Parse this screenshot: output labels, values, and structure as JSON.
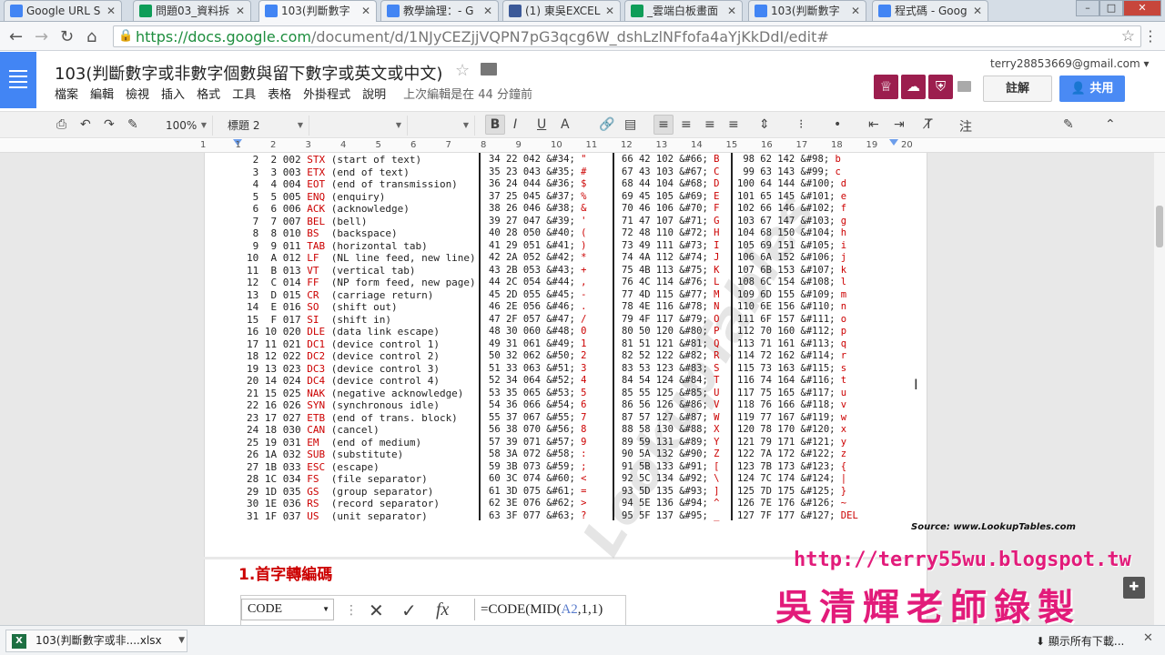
{
  "browser": {
    "tabs": [
      {
        "label": "Google URL S",
        "color": "#4285f4"
      },
      {
        "label": "問題03_資料拆",
        "color": "#0f9d58"
      },
      {
        "label": "103(判斷數字",
        "color": "#4285f4",
        "active": true
      },
      {
        "label": "教學論理：- G",
        "color": "#4285f4"
      },
      {
        "label": "(1) 東吳EXCEL",
        "color": "#3b5998"
      },
      {
        "label": "_雲端白板畫面",
        "color": "#0f9d58"
      },
      {
        "label": "103(判斷數字",
        "color": "#4285f4"
      },
      {
        "label": "程式碼 - Goog",
        "color": "#4285f4"
      }
    ],
    "url_host": "https://docs.google.com",
    "url_path": "/document/d/1NJyCEZjjVQPN7pG3qcg6W_dshLzlNFfofa4aYjKkDdI/edit#"
  },
  "doc": {
    "title": "103(判斷數字或非數字個數與留下數字或英文或中文)",
    "menu": [
      "檔案",
      "編輯",
      "檢視",
      "插入",
      "格式",
      "工具",
      "表格",
      "外掛程式",
      "說明"
    ],
    "last_edit": "上次編輯是在 44 分鐘前",
    "account": "terry28853669@gmail.com",
    "comment_label": "註解",
    "share_label": "共用"
  },
  "toolbar": {
    "zoom": "100%",
    "style": "標題 2",
    "font": "",
    "size": "",
    "bold": "B",
    "italic": "I",
    "underline": "U",
    "textcolor": "A",
    "comment_label": "注"
  },
  "ruler": [
    "1",
    "1",
    "2",
    "3",
    "4",
    "5",
    "6",
    "7",
    "8",
    "9",
    "10",
    "11",
    "12",
    "13",
    "14",
    "15",
    "16",
    "17",
    "18",
    "19",
    "20"
  ],
  "ascii": {
    "left_rows": [
      [
        "2",
        "2",
        "002",
        "STX",
        "(start of text)"
      ],
      [
        "3",
        "3",
        "003",
        "ETX",
        "(end of text)"
      ],
      [
        "4",
        "4",
        "004",
        "EOT",
        "(end of transmission)"
      ],
      [
        "5",
        "5",
        "005",
        "ENQ",
        "(enquiry)"
      ],
      [
        "6",
        "6",
        "006",
        "ACK",
        "(acknowledge)"
      ],
      [
        "7",
        "7",
        "007",
        "BEL",
        "(bell)"
      ],
      [
        "8",
        "8",
        "010",
        "BS",
        "(backspace)"
      ],
      [
        "9",
        "9",
        "011",
        "TAB",
        "(horizontal tab)"
      ],
      [
        "10",
        "A",
        "012",
        "LF",
        "(NL line feed, new line)"
      ],
      [
        "11",
        "B",
        "013",
        "VT",
        "(vertical tab)"
      ],
      [
        "12",
        "C",
        "014",
        "FF",
        "(NP form feed, new page)"
      ],
      [
        "13",
        "D",
        "015",
        "CR",
        "(carriage return)"
      ],
      [
        "14",
        "E",
        "016",
        "SO",
        "(shift out)"
      ],
      [
        "15",
        "F",
        "017",
        "SI",
        "(shift in)"
      ],
      [
        "16",
        "10",
        "020",
        "DLE",
        "(data link escape)"
      ],
      [
        "17",
        "11",
        "021",
        "DC1",
        "(device control 1)"
      ],
      [
        "18",
        "12",
        "022",
        "DC2",
        "(device control 2)"
      ],
      [
        "19",
        "13",
        "023",
        "DC3",
        "(device control 3)"
      ],
      [
        "20",
        "14",
        "024",
        "DC4",
        "(device control 4)"
      ],
      [
        "21",
        "15",
        "025",
        "NAK",
        "(negative acknowledge)"
      ],
      [
        "22",
        "16",
        "026",
        "SYN",
        "(synchronous idle)"
      ],
      [
        "23",
        "17",
        "027",
        "ETB",
        "(end of trans. block)"
      ],
      [
        "24",
        "18",
        "030",
        "CAN",
        "(cancel)"
      ],
      [
        "25",
        "19",
        "031",
        "EM",
        "(end of medium)"
      ],
      [
        "26",
        "1A",
        "032",
        "SUB",
        "(substitute)"
      ],
      [
        "27",
        "1B",
        "033",
        "ESC",
        "(escape)"
      ],
      [
        "28",
        "1C",
        "034",
        "FS",
        "(file separator)"
      ],
      [
        "29",
        "1D",
        "035",
        "GS",
        "(group separator)"
      ],
      [
        "30",
        "1E",
        "036",
        "RS",
        "(record separator)"
      ],
      [
        "31",
        "1F",
        "037",
        "US",
        "(unit separator)"
      ]
    ],
    "col2": [
      [
        "34 22 042 &#34;",
        "\""
      ],
      [
        "35 23 043 &#35;",
        "#"
      ],
      [
        "36 24 044 &#36;",
        "$"
      ],
      [
        "37 25 045 &#37;",
        "%"
      ],
      [
        "38 26 046 &#38;",
        "&"
      ],
      [
        "39 27 047 &#39;",
        "'"
      ],
      [
        "40 28 050 &#40;",
        "("
      ],
      [
        "41 29 051 &#41;",
        ")"
      ],
      [
        "42 2A 052 &#42;",
        "*"
      ],
      [
        "43 2B 053 &#43;",
        "+"
      ],
      [
        "44 2C 054 &#44;",
        ","
      ],
      [
        "45 2D 055 &#45;",
        "-"
      ],
      [
        "46 2E 056 &#46;",
        "."
      ],
      [
        "47 2F 057 &#47;",
        "/"
      ],
      [
        "48 30 060 &#48;",
        "0"
      ],
      [
        "49 31 061 &#49;",
        "1"
      ],
      [
        "50 32 062 &#50;",
        "2"
      ],
      [
        "51 33 063 &#51;",
        "3"
      ],
      [
        "52 34 064 &#52;",
        "4"
      ],
      [
        "53 35 065 &#53;",
        "5"
      ],
      [
        "54 36 066 &#54;",
        "6"
      ],
      [
        "55 37 067 &#55;",
        "7"
      ],
      [
        "56 38 070 &#56;",
        "8"
      ],
      [
        "57 39 071 &#57;",
        "9"
      ],
      [
        "58 3A 072 &#58;",
        ":"
      ],
      [
        "59 3B 073 &#59;",
        ";"
      ],
      [
        "60 3C 074 &#60;",
        "<"
      ],
      [
        "61 3D 075 &#61;",
        "="
      ],
      [
        "62 3E 076 &#62;",
        ">"
      ],
      [
        "63 3F 077 &#63;",
        "?"
      ]
    ],
    "col3": [
      [
        "66 42 102 &#66;",
        "B"
      ],
      [
        "67 43 103 &#67;",
        "C"
      ],
      [
        "68 44 104 &#68;",
        "D"
      ],
      [
        "69 45 105 &#69;",
        "E"
      ],
      [
        "70 46 106 &#70;",
        "F"
      ],
      [
        "71 47 107 &#71;",
        "G"
      ],
      [
        "72 48 110 &#72;",
        "H"
      ],
      [
        "73 49 111 &#73;",
        "I"
      ],
      [
        "74 4A 112 &#74;",
        "J"
      ],
      [
        "75 4B 113 &#75;",
        "K"
      ],
      [
        "76 4C 114 &#76;",
        "L"
      ],
      [
        "77 4D 115 &#77;",
        "M"
      ],
      [
        "78 4E 116 &#78;",
        "N"
      ],
      [
        "79 4F 117 &#79;",
        "O"
      ],
      [
        "80 50 120 &#80;",
        "P"
      ],
      [
        "81 51 121 &#81;",
        "Q"
      ],
      [
        "82 52 122 &#82;",
        "R"
      ],
      [
        "83 53 123 &#83;",
        "S"
      ],
      [
        "84 54 124 &#84;",
        "T"
      ],
      [
        "85 55 125 &#85;",
        "U"
      ],
      [
        "86 56 126 &#86;",
        "V"
      ],
      [
        "87 57 127 &#87;",
        "W"
      ],
      [
        "88 58 130 &#88;",
        "X"
      ],
      [
        "89 59 131 &#89;",
        "Y"
      ],
      [
        "90 5A 132 &#90;",
        "Z"
      ],
      [
        "91 5B 133 &#91;",
        "["
      ],
      [
        "92 5C 134 &#92;",
        "\\"
      ],
      [
        "93 5D 135 &#93;",
        "]"
      ],
      [
        "94 5E 136 &#94;",
        "^"
      ],
      [
        "95 5F 137 &#95;",
        "_"
      ]
    ],
    "col4": [
      [
        " 98 62 142 &#98;",
        "b"
      ],
      [
        " 99 63 143 &#99;",
        "c"
      ],
      [
        "100 64 144 &#100;",
        "d"
      ],
      [
        "101 65 145 &#101;",
        "e"
      ],
      [
        "102 66 146 &#102;",
        "f"
      ],
      [
        "103 67 147 &#103;",
        "g"
      ],
      [
        "104 68 150 &#104;",
        "h"
      ],
      [
        "105 69 151 &#105;",
        "i"
      ],
      [
        "106 6A 152 &#106;",
        "j"
      ],
      [
        "107 6B 153 &#107;",
        "k"
      ],
      [
        "108 6C 154 &#108;",
        "l"
      ],
      [
        "109 6D 155 &#109;",
        "m"
      ],
      [
        "110 6E 156 &#110;",
        "n"
      ],
      [
        "111 6F 157 &#111;",
        "o"
      ],
      [
        "112 70 160 &#112;",
        "p"
      ],
      [
        "113 71 161 &#113;",
        "q"
      ],
      [
        "114 72 162 &#114;",
        "r"
      ],
      [
        "115 73 163 &#115;",
        "s"
      ],
      [
        "116 74 164 &#116;",
        "t"
      ],
      [
        "117 75 165 &#117;",
        "u"
      ],
      [
        "118 76 166 &#118;",
        "v"
      ],
      [
        "119 77 167 &#119;",
        "w"
      ],
      [
        "120 78 170 &#120;",
        "x"
      ],
      [
        "121 79 171 &#121;",
        "y"
      ],
      [
        "122 7A 172 &#122;",
        "z"
      ],
      [
        "123 7B 173 &#123;",
        "{"
      ],
      [
        "124 7C 174 &#124;",
        "|"
      ],
      [
        "125 7D 175 &#125;",
        "}"
      ],
      [
        "126 7E 176 &#126;",
        "~"
      ],
      [
        "127 7F 177 &#127;",
        "DEL"
      ]
    ],
    "source": "Source:  www.LookupTables.com",
    "watermark": "LookupTables"
  },
  "content": {
    "heading": "1.首字轉編碼",
    "namebox": "CODE",
    "formula_prefix": "=CODE(MID(",
    "formula_ref": "A2",
    "formula_suffix": ",1,1)"
  },
  "overlay": {
    "blog": "http://terry55wu.blogspot.tw",
    "teacher": "吳清輝老師錄製",
    "color": "#e21b7a"
  },
  "downloads": {
    "file": "103(判斷數字或非....xlsx",
    "file_icon": "X",
    "show_all": "顯示所有下載..."
  }
}
